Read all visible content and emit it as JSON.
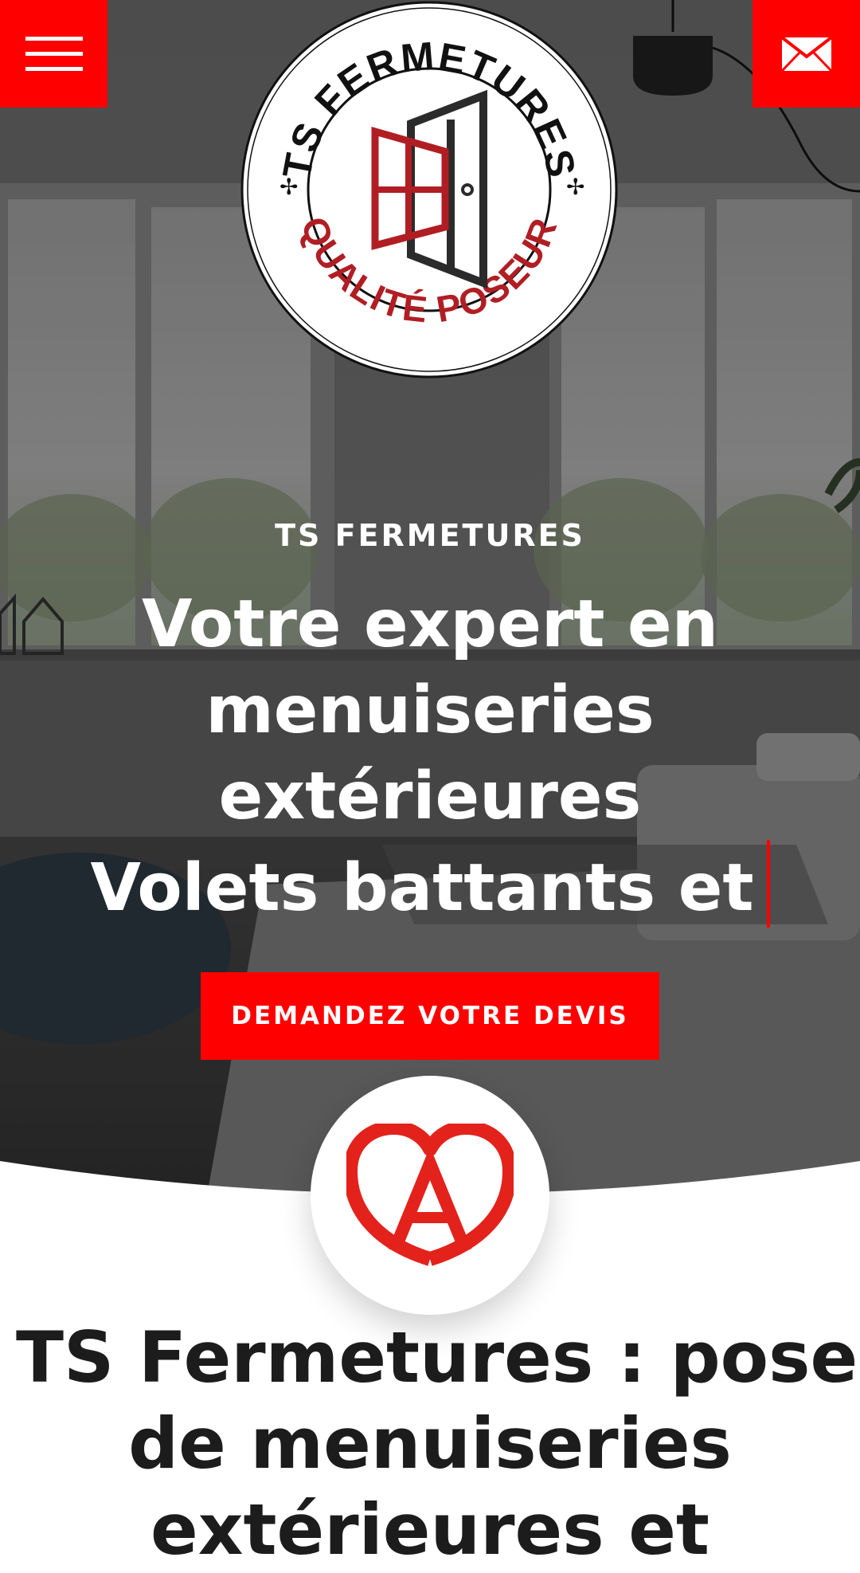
{
  "header": {
    "menu_icon": "hamburger-menu-icon",
    "mail_icon": "envelope-icon",
    "accent_color": "#ff0000"
  },
  "logo": {
    "top_text": "TS FERMETURES",
    "bottom_text": "QUALITÉ POSEUR",
    "icon": "window-and-door-icon",
    "bottom_color": "#b01e23"
  },
  "hero": {
    "eyebrow": "TS FERMETURES",
    "headline_lines": [
      "Votre expert en",
      "menuiseries",
      "extérieures",
      "Volets battants et"
    ],
    "cta_label": "DEMANDEZ VOTRE DEVIS"
  },
  "badge": {
    "icon": "alsace-heart-a-logo-icon",
    "color": "#e3221c"
  },
  "section": {
    "title_lines": [
      "TS Fermetures : pose",
      "de menuiseries",
      "extérieures et"
    ]
  }
}
